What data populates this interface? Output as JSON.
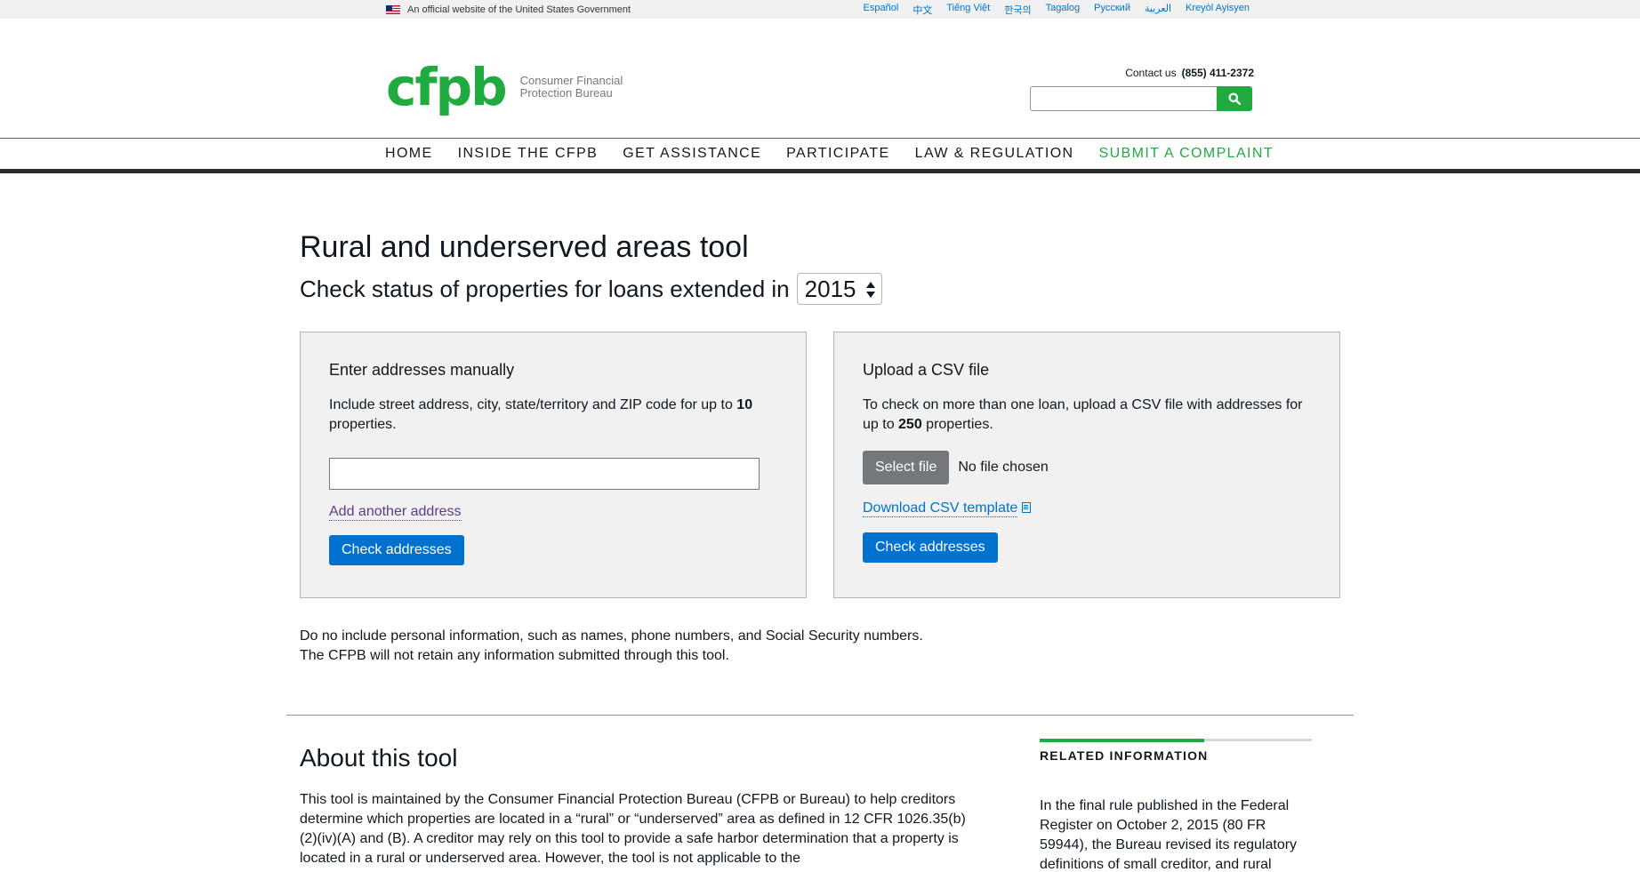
{
  "gov_banner": {
    "text": "An official website of the United States Government",
    "languages": [
      "Español",
      "中文",
      "Tiếng Việt",
      "한국의",
      "Tagalog",
      "Русский",
      "العربية",
      "Kreyòl Ayisyen"
    ]
  },
  "header": {
    "logo_mark": "cfpb",
    "logo_text_line1": "Consumer Financial",
    "logo_text_line2": "Protection Bureau",
    "contact_label": "Contact us",
    "contact_phone": "(855) 411-2372",
    "search_value": ""
  },
  "nav": {
    "items": [
      "HOME",
      "INSIDE THE CFPB",
      "GET ASSISTANCE",
      "PARTICIPATE",
      "LAW & REGULATION",
      "SUBMIT A COMPLAINT"
    ]
  },
  "main": {
    "title": "Rural and underserved areas tool",
    "subtitle": "Check status of properties for loans extended in",
    "year": "2015"
  },
  "manual_panel": {
    "heading": "Enter addresses manually",
    "desc_prefix": "Include street address, city, state/territory and ZIP code for up to ",
    "desc_count": "10",
    "desc_suffix": " properties.",
    "address_value": "",
    "add_link": "Add another address",
    "check_button": "Check addresses"
  },
  "csv_panel": {
    "heading": "Upload a CSV file",
    "desc_prefix": "To check on more than one loan, upload a CSV file with addresses for up to ",
    "desc_count": "250",
    "desc_suffix": " properties.",
    "select_button": "Select file",
    "file_status": "No file chosen",
    "template_link": "Download CSV template",
    "check_button": "Check addresses"
  },
  "notice": {
    "line1": "Do no include personal information, such as names, phone numbers, and Social Security numbers.",
    "line2": "The CFPB will not retain any information submitted through this tool."
  },
  "about": {
    "title": "About this tool",
    "text": "This tool is maintained by the Consumer Financial Protection Bureau (CFPB or Bureau) to help creditors determine which properties are located in a “rural” or “underserved” area as defined in 12 CFR 1026.35(b)(2)(iv)(A) and (B). A creditor may rely on this tool to provide a safe harbor determination that a property is located in a rural or underserved area. However, the tool is not applicable to the"
  },
  "related": {
    "heading": "RELATED INFORMATION",
    "text": "In the final rule published in the Federal Register on October 2, 2015 (80 FR 59944), the Bureau revised its regulatory definitions of small creditor, and rural"
  },
  "colors": {
    "brand_green": "#20aa3f",
    "action_blue": "#0072ce",
    "visited_purple": "#5b3a8f",
    "panel_bg": "#f1f1f1"
  }
}
